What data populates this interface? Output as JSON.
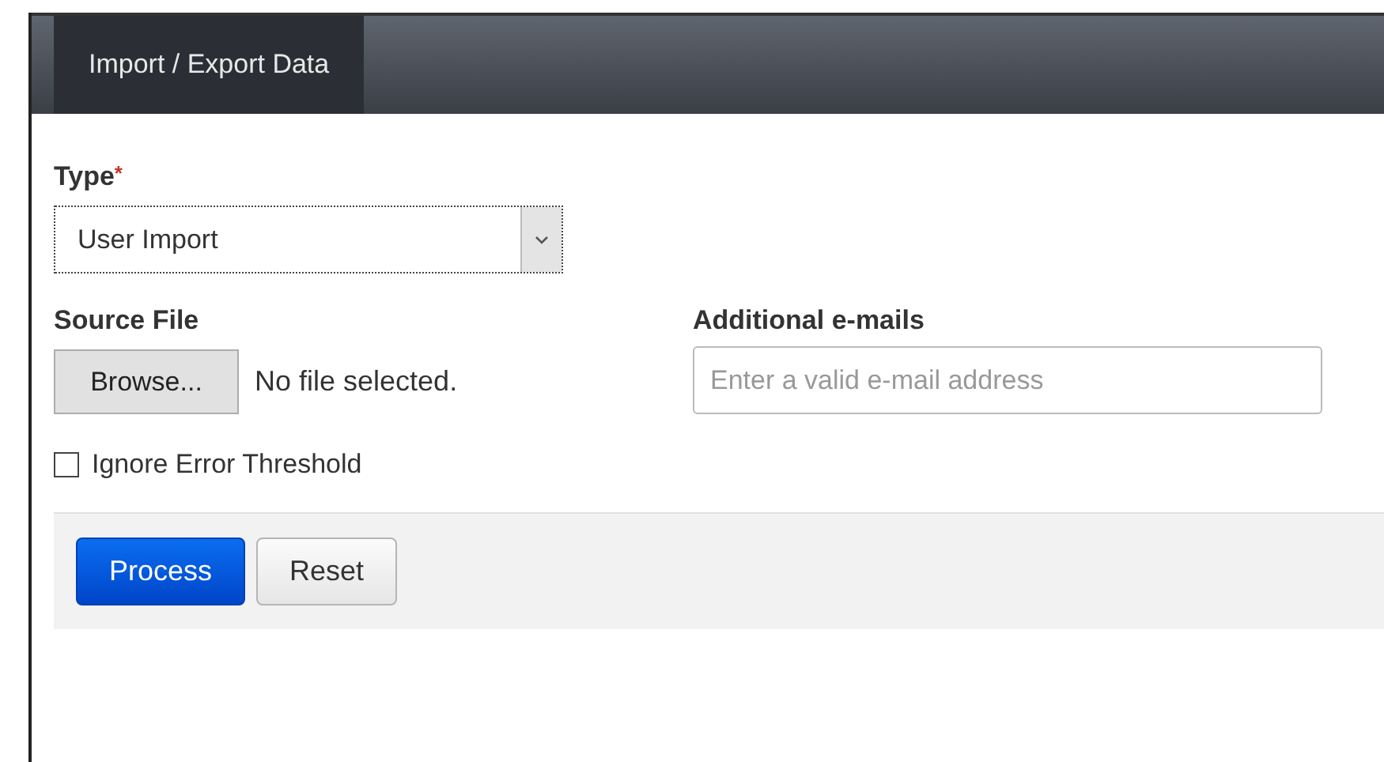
{
  "tabs": [
    {
      "label": "Import / Export Data",
      "selected": true
    }
  ],
  "type_field": {
    "label": "Type",
    "required_mark": "*",
    "value": "User Import"
  },
  "source_file": {
    "label": "Source File",
    "button": "Browse...",
    "status": "No file selected."
  },
  "emails": {
    "label": "Additional e-mails",
    "placeholder": "Enter a valid e-mail address"
  },
  "options": [
    {
      "label": "Ignore Error Threshold",
      "checked": false
    }
  ],
  "buttons": [
    {
      "label": "Process",
      "kind": "primary"
    },
    {
      "label": "Reset",
      "kind": "default"
    }
  ]
}
